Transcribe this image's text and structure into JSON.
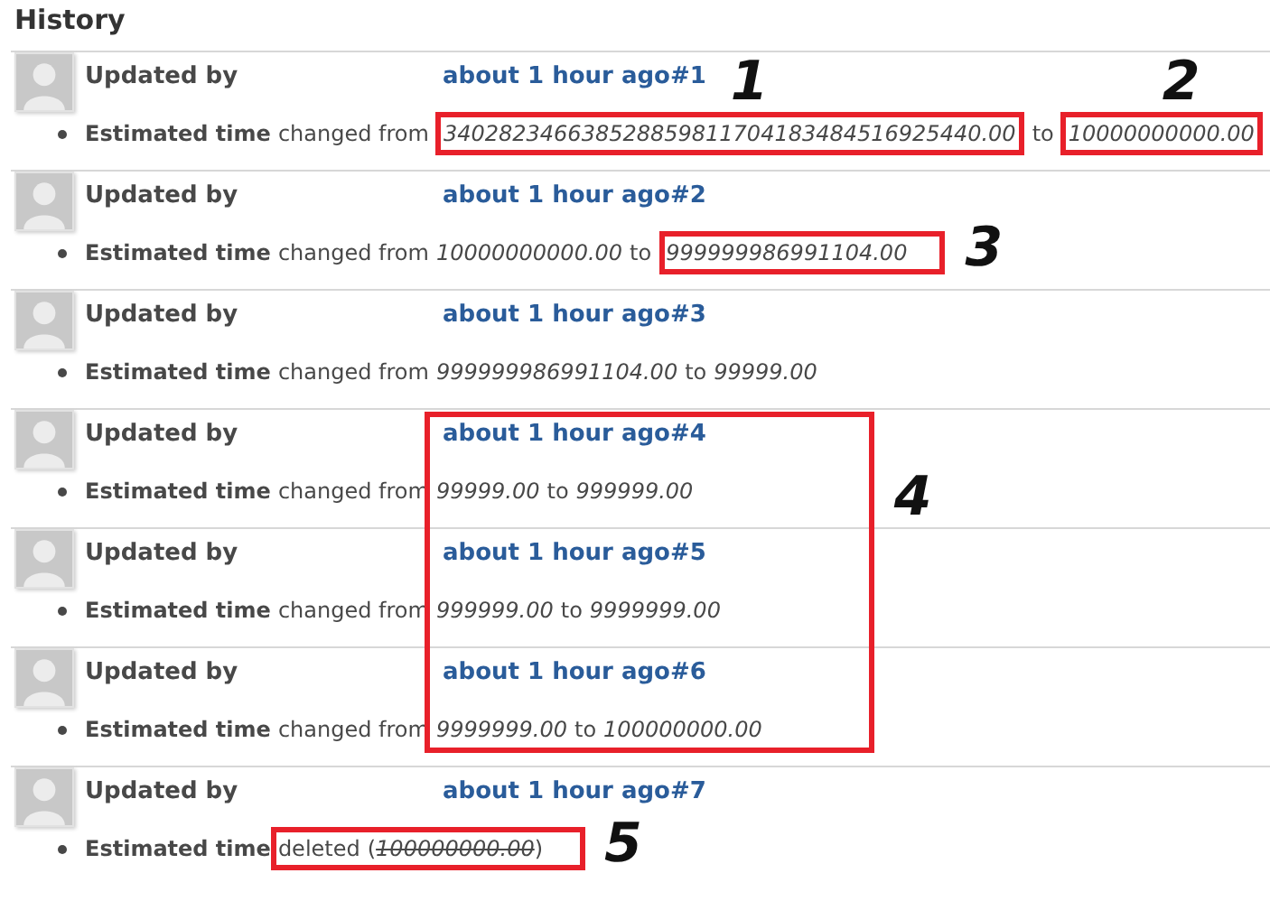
{
  "heading": "History",
  "entries": [
    {
      "author_label": "Updated by",
      "time": "about 1 hour ago",
      "number": "#1",
      "detail": {
        "kind": "changed",
        "field": "Estimated time",
        "verb": "changed from",
        "old": {
          "text": "340282346638528859811704183484516925440.00",
          "callout": "1"
        },
        "joiner": "to",
        "new": {
          "text": "10000000000.00",
          "callout": "2"
        }
      }
    },
    {
      "author_label": "Updated by",
      "time": "about 1 hour ago",
      "number": "#2",
      "detail": {
        "kind": "changed",
        "field": "Estimated time",
        "verb": "changed from",
        "old": {
          "text": "10000000000.00"
        },
        "joiner": "to",
        "new": {
          "text": "999999986991104.00",
          "callout": "3"
        }
      }
    },
    {
      "author_label": "Updated by",
      "time": "about 1 hour ago",
      "number": "#3",
      "detail": {
        "kind": "changed",
        "field": "Estimated time",
        "verb": "changed from",
        "old": {
          "text": "999999986991104.00"
        },
        "joiner": "to",
        "new": {
          "text": "99999.00"
        }
      }
    },
    {
      "author_label": "Updated by",
      "time": "about 1 hour ago",
      "number": "#4",
      "group_callout": "4",
      "detail": {
        "kind": "changed",
        "field": "Estimated time",
        "verb": "changed from",
        "old": {
          "text": "99999.00"
        },
        "joiner": "to",
        "new": {
          "text": "999999.00"
        }
      }
    },
    {
      "author_label": "Updated by",
      "time": "about 1 hour ago",
      "number": "#5",
      "group_continues": true,
      "detail": {
        "kind": "changed",
        "field": "Estimated time",
        "verb": "changed from",
        "old": {
          "text": "999999.00"
        },
        "joiner": "to",
        "new": {
          "text": "9999999.00"
        }
      }
    },
    {
      "author_label": "Updated by",
      "time": "about 1 hour ago",
      "number": "#6",
      "group_continues": true,
      "detail": {
        "kind": "changed",
        "field": "Estimated time",
        "verb": "changed from",
        "old": {
          "text": "9999999.00"
        },
        "joiner": "to",
        "new": {
          "text": "100000000.00"
        }
      }
    },
    {
      "author_label": "Updated by",
      "time": "about 1 hour ago",
      "number": "#7",
      "detail": {
        "kind": "deleted",
        "field": "Estimated time",
        "verb": "deleted",
        "open": "(",
        "old": {
          "text": "100000000.00"
        },
        "close": ")",
        "callout": "5"
      }
    }
  ]
}
